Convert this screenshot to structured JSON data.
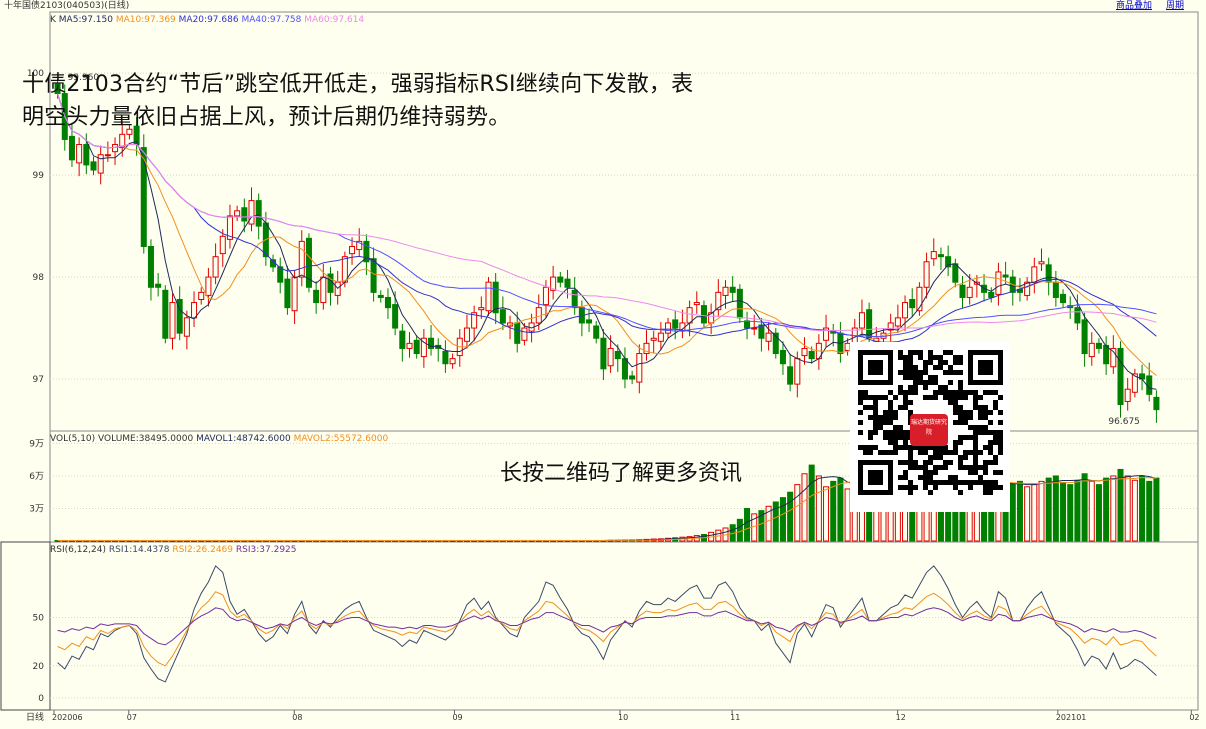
{
  "header": {
    "title": "十年国债2103(040503)(日线)",
    "overlay_link": "商品叠加",
    "period_link": "周期"
  },
  "annotation": {
    "line1": "十债2103合约“节后”跳空低开低走，强弱指标RSI继续向下发散，表",
    "line2": "明空头力量依旧占据上风，预计后期仍维持弱势。",
    "qr_caption": "长按二维码了解更多资讯",
    "qr_badge": "瑞达期货研究院"
  },
  "colors": {
    "background": "#fffff0",
    "up": "#e00000",
    "down": "#008000",
    "ma5": "#1e2a5a",
    "ma10": "#f0901e",
    "ma20": "#3030d0",
    "ma40": "#5050ff",
    "ma60": "#ee88ee",
    "rsi1": "#3a4a6a",
    "rsi2": "#f0901e",
    "rsi3": "#7030a0"
  },
  "chart_data": [
    {
      "type": "candlestick",
      "panel": "price",
      "legend_prefix": "K",
      "legend": [
        {
          "name": "MA5",
          "value": "97.150"
        },
        {
          "name": "MA10",
          "value": "97.369"
        },
        {
          "name": "MA20",
          "value": "97.686"
        },
        {
          "name": "MA40",
          "value": "97.758"
        },
        {
          "name": "MA60",
          "value": "97.614"
        }
      ],
      "y_ticks": [
        "100",
        "99",
        "98",
        "97"
      ],
      "ylim": [
        96.5,
        100.6
      ],
      "high_label": "99.960",
      "last_label": "96.675",
      "x_ticks": [
        "202006",
        "07",
        "08",
        "09",
        "10",
        "11",
        "12",
        "202101",
        "02"
      ],
      "close": [
        99.8,
        99.35,
        99.15,
        99.3,
        99.1,
        99.05,
        99.2,
        99.2,
        99.3,
        99.4,
        99.45,
        99.3,
        98.3,
        97.9,
        97.9,
        97.4,
        97.75,
        97.45,
        97.6,
        97.75,
        97.85,
        98.0,
        98.2,
        98.4,
        98.6,
        98.65,
        98.55,
        98.75,
        98.5,
        98.2,
        98.1,
        97.95,
        97.7,
        98.0,
        98.35,
        97.9,
        97.75,
        98.0,
        97.85,
        97.95,
        98.2,
        98.3,
        98.35,
        98.15,
        97.85,
        97.8,
        97.7,
        97.5,
        97.3,
        97.35,
        97.25,
        97.4,
        97.3,
        97.3,
        97.15,
        97.2,
        97.4,
        97.5,
        97.65,
        97.7,
        97.95,
        97.65,
        97.55,
        97.55,
        97.35,
        97.5,
        97.55,
        97.7,
        97.9,
        98.0,
        97.95,
        97.9,
        97.7,
        97.55,
        97.55,
        97.4,
        97.1,
        97.3,
        97.2,
        97.0,
        97.0,
        97.25,
        97.35,
        97.4,
        97.45,
        97.55,
        97.5,
        97.55,
        97.7,
        97.75,
        97.55,
        97.65,
        97.85,
        97.9,
        97.85,
        97.6,
        97.5,
        97.5,
        97.4,
        97.45,
        97.25,
        97.15,
        96.95,
        97.2,
        97.3,
        97.2,
        97.35,
        97.5,
        97.45,
        97.25,
        97.35,
        97.5,
        97.65,
        97.4,
        97.4,
        97.45,
        97.55,
        97.6,
        97.75,
        97.7,
        97.9,
        98.15,
        98.25,
        98.2,
        98.1,
        97.95,
        97.8,
        97.9,
        97.95,
        97.85,
        97.8,
        98.05,
        98.0,
        97.85,
        97.85,
        97.95,
        98.1,
        98.15,
        97.95,
        97.8,
        97.75,
        97.7,
        97.55,
        97.25,
        97.35,
        97.3,
        97.15,
        97.3,
        96.75,
        96.9,
        97.05,
        97.0,
        96.85,
        96.7
      ]
    },
    {
      "type": "bar",
      "panel": "volume",
      "legend": [
        {
          "name": "VOL(5,10)",
          "value": ""
        },
        {
          "name": "VOLUME",
          "value": "38495.0000"
        },
        {
          "name": "MAVOL1",
          "value": "48742.6000"
        },
        {
          "name": "MAVOL2",
          "value": "55572.6000"
        }
      ],
      "y_ticks": [
        "9万",
        "6万",
        "3万"
      ],
      "ylim": [
        0,
        95000
      ],
      "values": [
        500,
        500,
        500,
        500,
        500,
        500,
        500,
        500,
        500,
        500,
        500,
        500,
        500,
        500,
        500,
        500,
        500,
        500,
        500,
        500,
        500,
        500,
        500,
        500,
        500,
        500,
        500,
        500,
        500,
        500,
        500,
        500,
        500,
        500,
        500,
        500,
        500,
        500,
        500,
        500,
        500,
        500,
        500,
        500,
        500,
        500,
        500,
        500,
        500,
        500,
        500,
        500,
        500,
        500,
        500,
        500,
        500,
        500,
        500,
        500,
        500,
        500,
        500,
        500,
        500,
        500,
        500,
        500,
        500,
        500,
        500,
        500,
        500,
        500,
        500,
        500,
        500,
        600,
        700,
        800,
        1000,
        1200,
        1500,
        1800,
        2000,
        2500,
        3000,
        3500,
        4000,
        5000,
        6000,
        8000,
        10000,
        12000,
        15000,
        20000,
        30000,
        25000,
        28000,
        32000,
        36000,
        40000,
        45000,
        52000,
        62000,
        70000,
        60000,
        50000,
        55000,
        58000,
        48000,
        52000,
        46000,
        50000,
        48000,
        56000,
        52000,
        50000,
        48000,
        46000,
        50000,
        55000,
        52000,
        60000,
        58000,
        54000,
        52000,
        56000,
        53000,
        55000,
        54000,
        52000,
        50000,
        53000,
        55000,
        50000,
        52000,
        55000,
        58000,
        60000,
        54000,
        52000,
        56000,
        62000,
        55000,
        52000,
        58000,
        60000,
        66000,
        60000,
        56000,
        60000,
        55000,
        58000,
        54000,
        50000,
        42000,
        38000,
        38000
      ],
      "ma1": [
        48742.6
      ],
      "ma2": [
        55572.6
      ]
    },
    {
      "type": "line",
      "panel": "rsi",
      "legend": [
        {
          "name": "RSI(6,12,24)",
          "value": ""
        },
        {
          "name": "RSI1",
          "value": "14.4378"
        },
        {
          "name": "RSI2",
          "value": "26.2469"
        },
        {
          "name": "RSI3",
          "value": "37.2925"
        }
      ],
      "y_ticks": [
        "50",
        "20",
        "0"
      ],
      "ylim": [
        0,
        95
      ],
      "series": [
        {
          "name": "RSI1",
          "values": [
            22,
            18,
            26,
            24,
            32,
            30,
            40,
            38,
            42,
            44,
            45,
            40,
            25,
            18,
            12,
            10,
            20,
            30,
            40,
            55,
            65,
            72,
            82,
            78,
            60,
            52,
            55,
            48,
            40,
            35,
            38,
            45,
            40,
            52,
            60,
            45,
            40,
            48,
            44,
            50,
            55,
            58,
            60,
            50,
            42,
            40,
            38,
            36,
            32,
            36,
            34,
            42,
            40,
            38,
            36,
            40,
            48,
            58,
            62,
            55,
            60,
            50,
            45,
            40,
            38,
            50,
            55,
            60,
            72,
            70,
            62,
            55,
            45,
            40,
            38,
            32,
            24,
            36,
            42,
            48,
            44,
            54,
            60,
            58,
            58,
            62,
            60,
            64,
            68,
            70,
            62,
            62,
            70,
            72,
            66,
            56,
            50,
            48,
            42,
            46,
            34,
            28,
            22,
            40,
            46,
            38,
            48,
            58,
            56,
            44,
            50,
            56,
            62,
            48,
            48,
            52,
            56,
            58,
            64,
            62,
            70,
            78,
            82,
            76,
            68,
            58,
            50,
            56,
            60,
            54,
            50,
            66,
            62,
            48,
            48,
            56,
            62,
            66,
            56,
            46,
            42,
            38,
            30,
            20,
            26,
            24,
            18,
            28,
            18,
            20,
            24,
            22,
            18,
            14
          ]
        },
        {
          "name": "RSI2",
          "values": [
            32,
            30,
            34,
            32,
            38,
            36,
            42,
            40,
            43,
            44,
            45,
            42,
            32,
            26,
            22,
            20,
            26,
            34,
            42,
            50,
            56,
            60,
            66,
            64,
            54,
            50,
            52,
            48,
            43,
            40,
            42,
            46,
            43,
            50,
            54,
            46,
            43,
            47,
            45,
            48,
            51,
            53,
            54,
            49,
            45,
            43,
            42,
            41,
            39,
            41,
            40,
            44,
            43,
            42,
            41,
            43,
            47,
            52,
            55,
            51,
            54,
            49,
            46,
            43,
            42,
            48,
            51,
            54,
            60,
            59,
            55,
            51,
            46,
            43,
            42,
            39,
            35,
            41,
            44,
            47,
            46,
            51,
            54,
            53,
            53,
            55,
            54,
            56,
            58,
            59,
            55,
            55,
            59,
            60,
            57,
            52,
            49,
            48,
            45,
            47,
            41,
            38,
            35,
            44,
            47,
            43,
            48,
            53,
            52,
            46,
            49,
            52,
            55,
            48,
            48,
            50,
            52,
            53,
            56,
            55,
            59,
            63,
            65,
            62,
            58,
            53,
            49,
            52,
            54,
            51,
            49,
            57,
            55,
            48,
            48,
            52,
            55,
            57,
            52,
            47,
            45,
            43,
            39,
            34,
            37,
            36,
            33,
            38,
            33,
            34,
            36,
            35,
            30,
            26
          ]
        },
        {
          "name": "RSI3",
          "values": [
            42,
            41,
            43,
            42,
            44,
            43,
            46,
            45,
            46,
            46,
            46,
            45,
            40,
            37,
            34,
            33,
            36,
            40,
            44,
            48,
            51,
            53,
            56,
            55,
            50,
            48,
            49,
            47,
            45,
            43,
            44,
            46,
            45,
            48,
            50,
            47,
            45,
            47,
            46,
            47,
            49,
            50,
            50,
            48,
            46,
            45,
            44,
            44,
            43,
            44,
            43,
            45,
            45,
            44,
            44,
            45,
            47,
            49,
            51,
            49,
            51,
            48,
            47,
            45,
            45,
            47,
            49,
            50,
            53,
            53,
            51,
            49,
            47,
            45,
            45,
            43,
            41,
            44,
            45,
            47,
            46,
            49,
            50,
            50,
            50,
            51,
            51,
            52,
            53,
            53,
            51,
            51,
            53,
            54,
            52,
            50,
            48,
            48,
            46,
            47,
            44,
            43,
            41,
            45,
            47,
            45,
            47,
            50,
            49,
            47,
            48,
            49,
            51,
            48,
            48,
            49,
            50,
            50,
            52,
            51,
            53,
            55,
            56,
            55,
            53,
            50,
            48,
            50,
            51,
            49,
            48,
            52,
            51,
            48,
            48,
            50,
            51,
            52,
            50,
            48,
            47,
            46,
            44,
            41,
            43,
            42,
            41,
            43,
            41,
            41,
            42,
            41,
            39,
            37
          ]
        }
      ]
    }
  ]
}
